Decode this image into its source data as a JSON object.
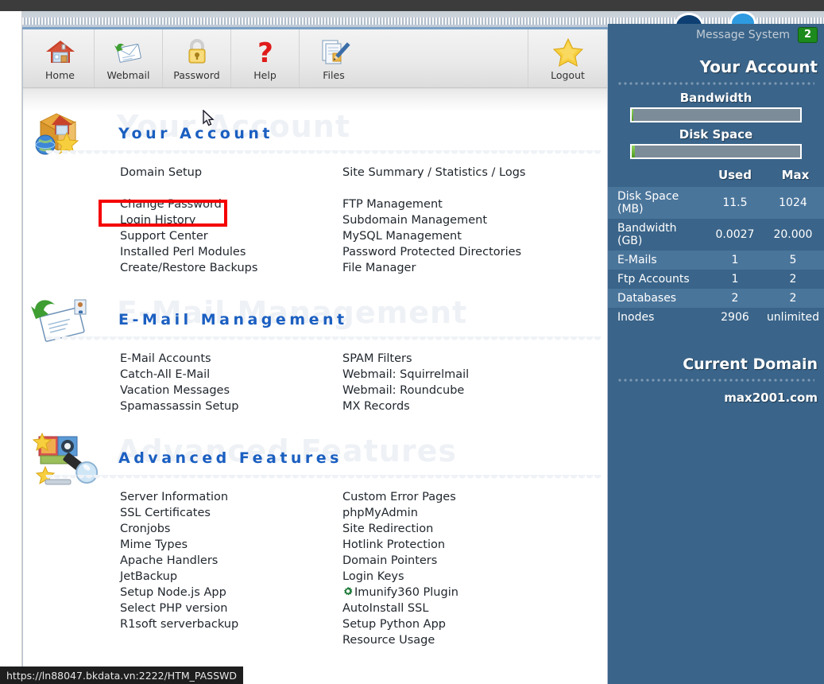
{
  "window": {
    "status_bar_url": "https://ln88047.bkdata.vn:2222/HTM_PASSWD"
  },
  "toolbar": {
    "items": [
      {
        "label": "Home",
        "icon": "house-icon"
      },
      {
        "label": "Webmail",
        "icon": "envelope-icon"
      },
      {
        "label": "Password",
        "icon": "padlock-icon"
      },
      {
        "label": "Help",
        "icon": "question-mark-icon"
      },
      {
        "label": "Files",
        "icon": "documents-pencil-icon"
      },
      {
        "label": "Logout",
        "icon": "star-icon"
      }
    ]
  },
  "sections": [
    {
      "id": "your-account",
      "title": "Your Account",
      "icon": "package-globe-star-icon",
      "left_links": [
        "Domain Setup",
        "",
        "Change Password",
        "Login History",
        "Support Center",
        "Installed Perl Modules",
        "Create/Restore Backups"
      ],
      "right_links": [
        "Site Summary / Statistics / Logs",
        "",
        "FTP Management",
        "Subdomain Management",
        "MySQL Management",
        "Password Protected Directories",
        "File Manager"
      ]
    },
    {
      "id": "e-mail-management",
      "title": "E-Mail Management",
      "icon": "envelope-arrow-icon",
      "left_links": [
        "E-Mail Accounts",
        "Catch-All E-Mail",
        "Vacation Messages",
        "Spamassassin Setup"
      ],
      "right_links": [
        "SPAM Filters",
        "Webmail: Squirrelmail",
        "Webmail: Roundcube",
        "MX Records"
      ]
    },
    {
      "id": "advanced-features",
      "title": "Advanced Features",
      "icon": "magnifier-photos-icon",
      "left_links": [
        "Server Information",
        "SSL Certificates",
        "Cronjobs",
        "Mime Types",
        "Apache Handlers",
        "JetBackup",
        "Setup Node.js App",
        "Select PHP version",
        "R1soft serverbackup"
      ],
      "right_links": [
        "Custom Error Pages",
        "phpMyAdmin",
        "Site Redirection",
        "Hotlink Protection",
        "Domain Pointers",
        "Login Keys",
        "Imunify360 Plugin",
        "AutoInstall SSL",
        "Setup Python App",
        "Resource Usage"
      ],
      "right_link_icons": {
        "6": "green-gear-icon"
      }
    }
  ],
  "sidebar": {
    "message_system_label": "Message System",
    "message_count": "2",
    "account_title": "Your Account",
    "bandwidth_label": "Bandwidth",
    "bandwidth_percent": 1,
    "disk_space_label": "Disk Space",
    "disk_space_percent": 2,
    "table_headers": {
      "metric": "",
      "used": "Used",
      "max": "Max"
    },
    "rows": [
      {
        "metric": "Disk Space (MB)",
        "used": "11.5",
        "max": "1024"
      },
      {
        "metric": "Bandwidth (GB)",
        "used": "0.0027",
        "max": "20.000"
      },
      {
        "metric": "E-Mails",
        "used": "1",
        "max": "5"
      },
      {
        "metric": "Ftp Accounts",
        "used": "1",
        "max": "2"
      },
      {
        "metric": "Databases",
        "used": "2",
        "max": "2"
      },
      {
        "metric": "Inodes",
        "used": "2906",
        "max": "unlimited"
      }
    ],
    "current_domain_title": "Current Domain",
    "current_domain_value": "max2001.com"
  },
  "annotation": {
    "highlight_target": "Domain Setup",
    "highlight_color": "#f50000"
  }
}
